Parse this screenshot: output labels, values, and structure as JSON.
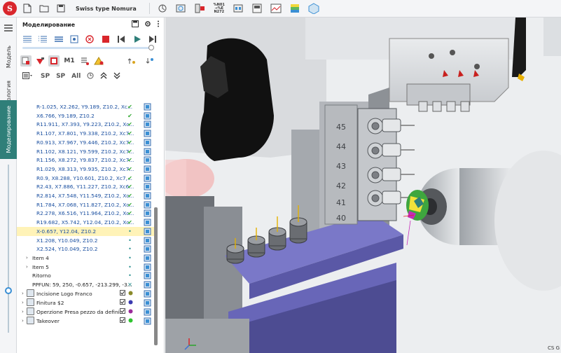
{
  "app": {
    "document_title": "Swiss type Nomura"
  },
  "toolbar": {
    "text_icon_lines": [
      "%N01",
      "→%E",
      "N272"
    ]
  },
  "rail": {
    "tabs": [
      {
        "label": "Модель",
        "active": false
      },
      {
        "label": "Технология",
        "active": false
      },
      {
        "label": "Моделирование",
        "active": true
      }
    ]
  },
  "panel": {
    "title": "Моделирование",
    "progress_fraction": 1.0,
    "tool_labels": {
      "sp1": "SP",
      "sp2": "SP",
      "all": "All",
      "m1": "M1"
    }
  },
  "tree": {
    "rows": [
      {
        "text": "R-1.025, X2.262, Y9.189, Z10.2, Xc...",
        "status": "check"
      },
      {
        "text": "X6.766, Y9.189, Z10.2",
        "status": "check"
      },
      {
        "text": "R11.911, X7.393, Y9.223, Z10.2, Xc...",
        "status": "check"
      },
      {
        "text": "R1.107, X7.801, Y9.338, Z10.2, Xc7...",
        "status": "check"
      },
      {
        "text": "R0.913, X7.967, Y9.446, Z10.2, Xc7...",
        "status": "check"
      },
      {
        "text": "R1.102, X8.121, Y9.599, Z10.2, Xc7...",
        "status": "check"
      },
      {
        "text": "R1.156, X8.272, Y9.837, Z10.2, Xc7...",
        "status": "check"
      },
      {
        "text": "R1.029, X8.313, Y9.935, Z10.2, Xc7...",
        "status": "check"
      },
      {
        "text": "R0.9, X8.288, Y10.601, Z10.2, Xc7,...",
        "status": "check"
      },
      {
        "text": "R2.43, X7.886, Y11.227, Z10.2, Xc6...",
        "status": "check"
      },
      {
        "text": "R2.814, X7.548, Y11.549, Z10.2, Xc...",
        "status": "check"
      },
      {
        "text": "R1.784, X7.068, Y11.827, Z10.2, Xc...",
        "status": "check"
      },
      {
        "text": "R2.278, X6.516, Y11.964, Z10.2, Xc...",
        "status": "check"
      },
      {
        "text": "R19.682, X5.742, Y12.04, Z10.2, Xc...",
        "status": "check"
      },
      {
        "text": "X-0.657, Y12.04, Z10.2",
        "status": "dot",
        "selected": true
      },
      {
        "text": "X1.208, Y10.049, Z10.2",
        "status": "dot"
      },
      {
        "text": "X2.524, Y10.049, Z10.2",
        "status": "dot"
      },
      {
        "text": "Item 4",
        "status": "dot",
        "group": true
      },
      {
        "text": "Item 5",
        "status": "dot",
        "group": true
      },
      {
        "text": "Ritorno",
        "status": "dot",
        "plain": true
      },
      {
        "text": "PPFUN: 59, 250, -0.657, -213.299, -3...",
        "status": "cross",
        "plain": true
      }
    ],
    "operations": [
      {
        "text": "Incisione Logo Franco",
        "color": "#8a8a2a"
      },
      {
        "text": "Finitura $2",
        "color": "#3a3ab0"
      },
      {
        "text": "Operzione Presa pezzo da definire",
        "color": "#9a2a9a"
      },
      {
        "text": "Takeover",
        "color": "#2ec42e"
      }
    ]
  },
  "viewport": {
    "cs_label": "CS G",
    "engravings": [
      "45",
      "44",
      "43",
      "42",
      "41",
      "40"
    ]
  },
  "colors": {
    "accent": "#2f7f79",
    "link_blue": "#1a4fa0",
    "check_green": "#2ca52c",
    "selected_row": "#fff3b8",
    "logo_red": "#d9262c"
  }
}
